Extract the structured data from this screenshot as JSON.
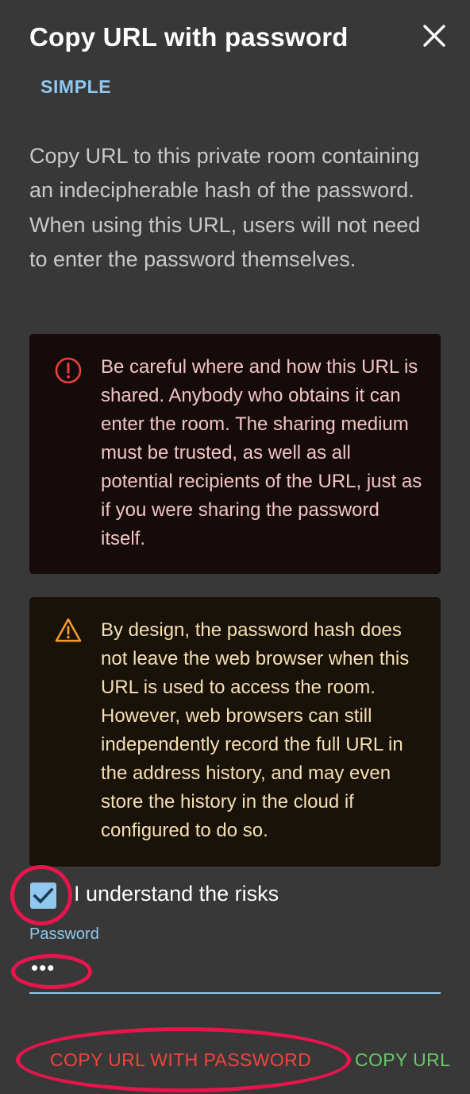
{
  "dialog": {
    "title": "Copy URL with password",
    "tab_label": "SIMPLE",
    "intro": "Copy URL to this private room containing an indecipherable hash of the password. When using this URL, users will not need to enter the password themselves."
  },
  "alerts": {
    "error_text": "Be careful where and how this URL is shared. Anybody who obtains it can enter the room. The sharing medium must be trusted, as well as all potential recipients of the URL, just as if you were sharing the password itself.",
    "warning_text": "By design, the password hash does not leave the web browser when this URL is used to access the room. However, web browsers can still independently record the full URL in the address history, and may even store the history in the cloud if configured to do so."
  },
  "form": {
    "checkbox_label": "I understand the risks",
    "checkbox_checked": true,
    "password_label": "Password",
    "password_value": "•••"
  },
  "actions": {
    "copy_with_password": "COPY URL WITH PASSWORD",
    "copy_url": "COPY URL"
  },
  "colors": {
    "background": "#383838",
    "accent": "#90c8f0",
    "error": "#f0453c",
    "success": "#6ac86a",
    "highlight": "#e8154c"
  },
  "icons": {
    "close": "close-icon",
    "error": "error-circle-icon",
    "warning": "warning-triangle-icon",
    "check": "check-icon"
  }
}
